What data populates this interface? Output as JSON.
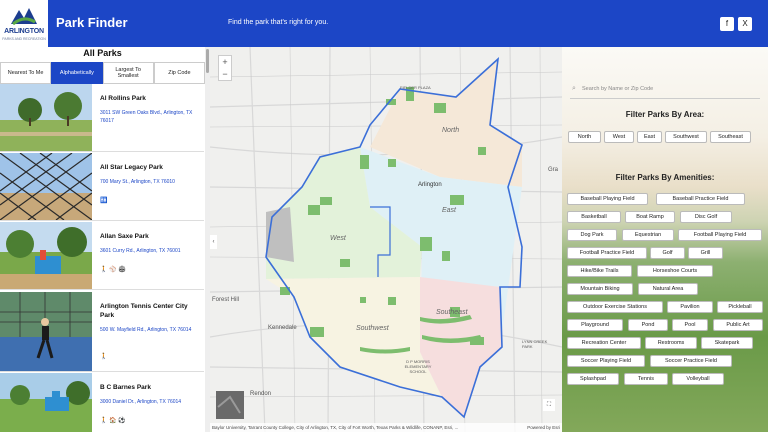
{
  "header": {
    "logo_name": "ARLINGTON",
    "logo_sub": "PARKS AND RECREATION",
    "title": "Park Finder",
    "tagline": "Find the park that's right for you.",
    "social": [
      "facebook-icon",
      "x-icon"
    ],
    "social_labels": [
      "f",
      "X"
    ]
  },
  "list": {
    "heading": "All Parks",
    "sort_options": [
      "Nearest To Me",
      "Alphabetically",
      "Largest To Smallest",
      "Zip Code"
    ],
    "active_sort": "Alphabetically",
    "parks": [
      {
        "name": "Al Rollins Park",
        "address": "3011 SW Green Oaks Blvd., Arlington, TX 76017",
        "icons": ""
      },
      {
        "name": "All Star Legacy Park",
        "address": "700 Mary St., Arlington, TX 76010",
        "icons": "🚻"
      },
      {
        "name": "Allan Saxe Park",
        "address": "3601 Curry Rd., Arlington, TX 76001",
        "icons": "🚶 ⚾ 🏟"
      },
      {
        "name": "Arlington Tennis Center City Park",
        "address": "500 W. Mayfield Rd., Arlington, TX 76014",
        "icons": "🚶"
      },
      {
        "name": "B C Barnes Park",
        "address": "3000 Daniel Dr., Arlington, TX 76014",
        "icons": "🚶 🏠 ⚽"
      }
    ]
  },
  "map": {
    "labels": {
      "north": "North",
      "east": "East",
      "west": "West",
      "southwest": "Southwest",
      "southeast": "Southeast",
      "arlington": "Arlington",
      "forest_hill": "Forest Hill",
      "kennedale": "Kennedale",
      "rendon": "Rendon",
      "grand_prairie": "Gra",
      "lynn_creek": "LYNN CREEK PARK",
      "elementary": "D P MORRIS ELEMENTARY SCHOOL",
      "fielder": "FIELDER PLAZA",
      "zoom_in": "+",
      "zoom_out": "−",
      "basemap_label": "",
      "collapse": "‹",
      "fullscreen": "⛶"
    },
    "attribution": "Baylor University, Tarrant County College, City of Arlington, TX, City of Fort Worth, Texas Parks & Wildlife, CONANP, Esri, ...",
    "powered": "Powered by Esri"
  },
  "filters": {
    "search_placeholder": "Search by Name or Zip Code",
    "area_title": "Filter Parks By Area:",
    "areas": [
      "North",
      "West",
      "East",
      "Southwest",
      "Southeast"
    ],
    "amenities_title": "Filter Parks By Amenities:",
    "amenities": [
      "Baseball Playing Field",
      "Baseball Practice Field",
      "Basketball",
      "Boat Ramp",
      "Disc Golf",
      "Dog Park",
      "Equestrian",
      "Football Playing Field",
      "Football Practice Field",
      "Golf",
      "Grill",
      "Hike/Bike Trails",
      "Horseshoe Courts",
      "Mountain Biking",
      "Natural Area",
      "Outdoor Exercise Stations",
      "Pavilion",
      "Pickleball",
      "Playground",
      "Pond",
      "Pool",
      "Public Art",
      "Recreation Center",
      "Restrooms",
      "Skatepark",
      "Soccer Playing Field",
      "Soccer Practice Field",
      "Splashpad",
      "Tennis",
      "Volleyball"
    ]
  },
  "colors": {
    "brand": "#1c46c6",
    "north": "#f5e8d8",
    "east": "#dff0f6",
    "west": "#e3f2da",
    "southwest": "#f7f3e2",
    "southeast": "#f6dede",
    "park": "#7dbd6e",
    "boundary": "#3b6fd8"
  }
}
